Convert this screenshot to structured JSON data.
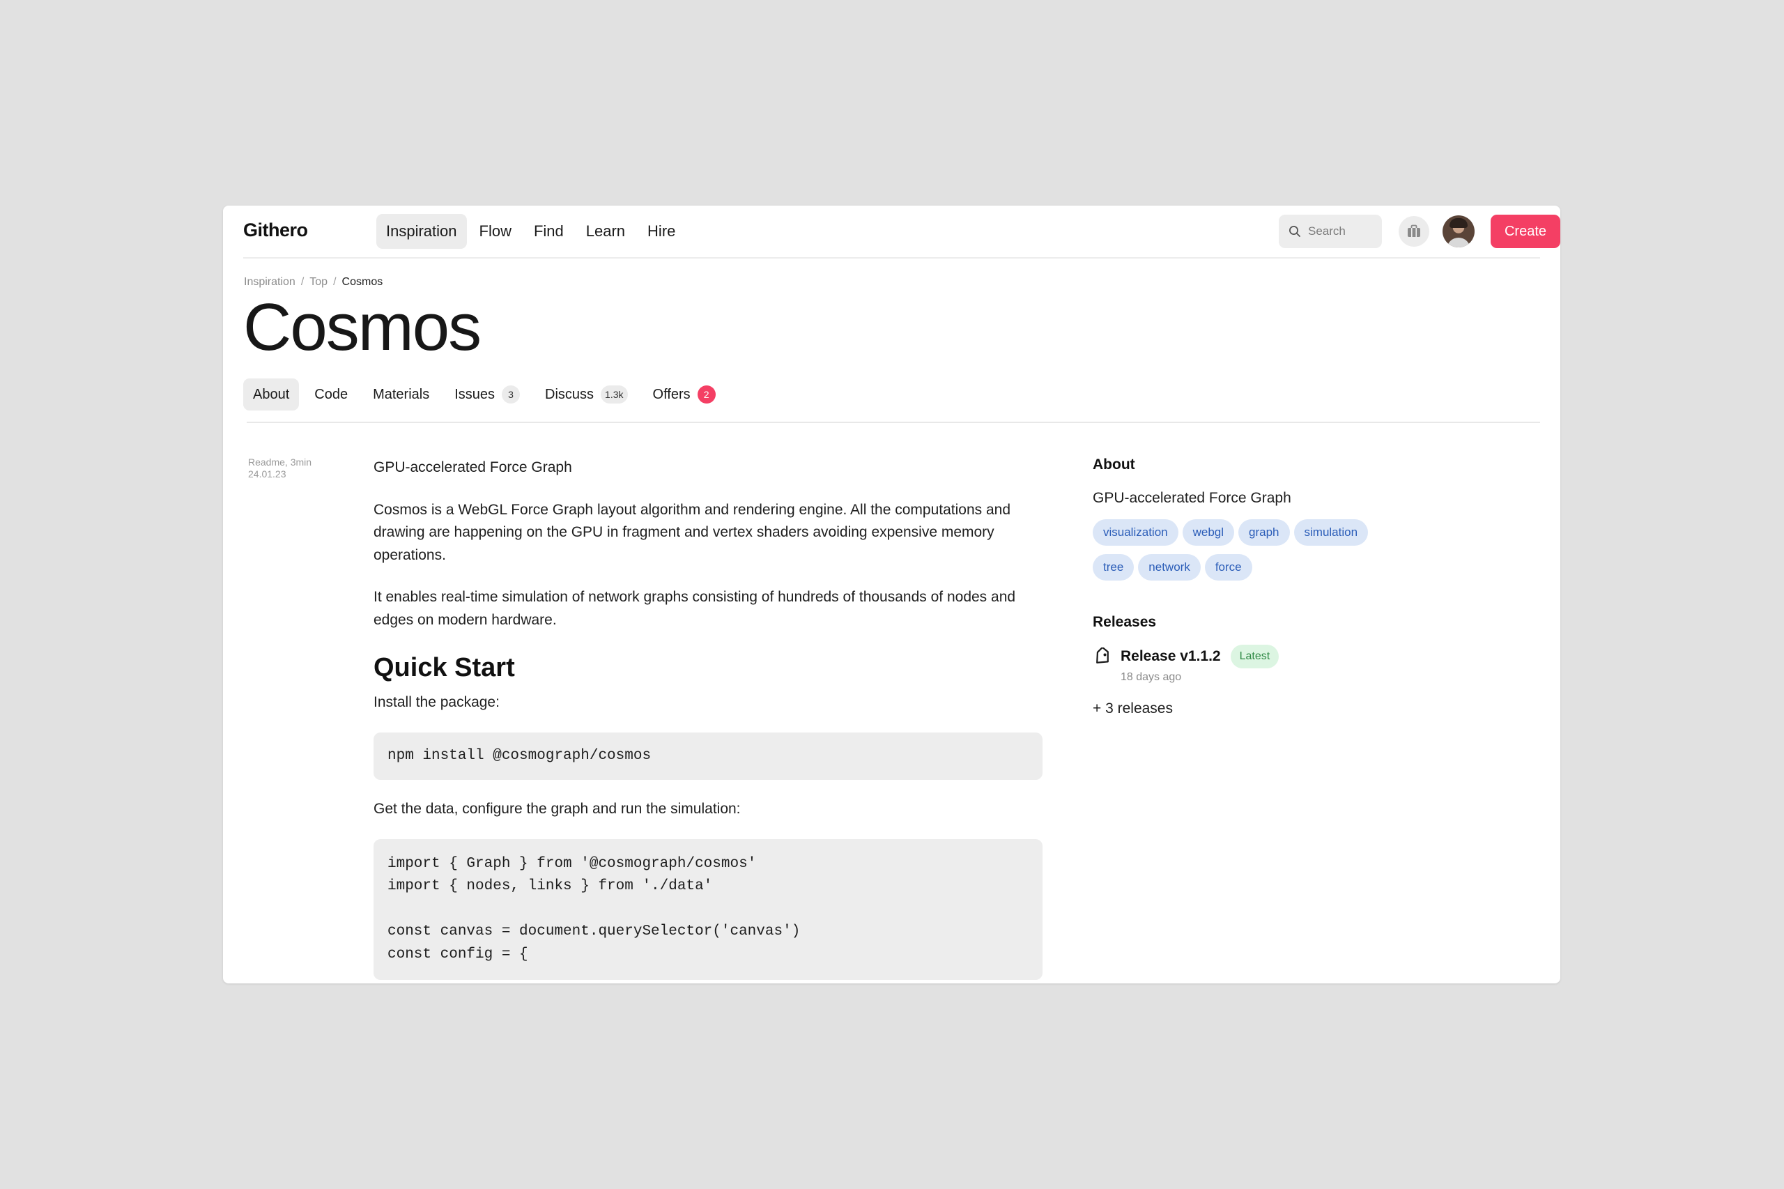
{
  "app": {
    "name": "Githero"
  },
  "nav": {
    "items": [
      {
        "label": "Inspiration",
        "active": true
      },
      {
        "label": "Flow"
      },
      {
        "label": "Find"
      },
      {
        "label": "Learn"
      },
      {
        "label": "Hire"
      }
    ]
  },
  "search": {
    "placeholder": "Search",
    "icon": "search-icon"
  },
  "toolbar": {
    "briefcase_icon": "briefcase-icon",
    "create_label": "Create",
    "accent_color": "#f43f64"
  },
  "breadcrumb": [
    "Inspiration",
    "Top",
    "Cosmos"
  ],
  "page": {
    "title": "Cosmos"
  },
  "tabs": [
    {
      "label": "About",
      "active": true
    },
    {
      "label": "Code"
    },
    {
      "label": "Materials"
    },
    {
      "label": "Issues",
      "count": "3"
    },
    {
      "label": "Discuss",
      "count": "1.3k"
    },
    {
      "label": "Offers",
      "count": "2"
    }
  ],
  "meta": {
    "line1": "Readme, 3min",
    "line2": "24.01.23"
  },
  "readme": {
    "lead": "GPU-accelerated Force Graph",
    "para1": "Cosmos is a WebGL Force Graph layout algorithm and rendering engine. All the computations and drawing are happening on the GPU in fragment and vertex shaders avoiding expensive memory operations.",
    "para2": "It enables real-time simulation of network graphs consisting of hundreds of thousands of nodes and edges on modern hardware.",
    "quick_start": "Quick Start",
    "install_text": "Install the package:",
    "install_code": "npm install @cosmograph/cosmos",
    "config_text": "Get the data, configure the graph and run the simulation:",
    "config_code": [
      "import { Graph } from '@cosmograph/cosmos'",
      "import { nodes, links } from './data'",
      "",
      "const canvas = document.querySelector('canvas')",
      "const config = {"
    ]
  },
  "sidebar": {
    "about_title": "About",
    "about_desc": "GPU-accelerated Force Graph",
    "tags": [
      "visualization",
      "webgl",
      "graph",
      "simulation",
      "tree",
      "network",
      "force"
    ],
    "releases_title": "Releases",
    "release": {
      "name": "Release v1.1.2",
      "badge": "Latest",
      "date": "18 days ago"
    },
    "more_releases": "+ 3 releases"
  }
}
